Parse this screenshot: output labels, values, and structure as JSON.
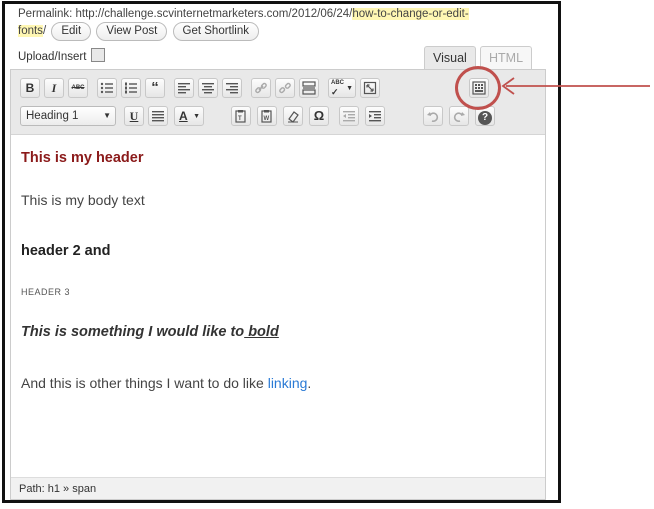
{
  "permalink": {
    "prefix": "Permalink: http://challenge.scvinternetmarketers.com/2012/06/24/",
    "slug_part1": "how-to-change-or-edit-",
    "slug_part2": "fonts",
    "suffix": "/",
    "edit": "Edit",
    "view_post": "View Post",
    "get_shortlink": "Get Shortlink"
  },
  "upload": {
    "label": "Upload/Insert"
  },
  "tabs": {
    "visual": "Visual",
    "html": "HTML"
  },
  "toolbar": {
    "row1": [
      "bold-icon",
      "italic-icon",
      "strikethrough-icon",
      "bullet-list-icon",
      "numbered-list-icon",
      "blockquote-icon",
      "align-left-icon",
      "align-center-icon",
      "align-right-icon",
      "link-icon",
      "unlink-icon",
      "insert-more-icon",
      "spellcheck-icon",
      "fullscreen-icon",
      "kitchen-sink-icon"
    ],
    "row2": [
      "underline-icon",
      "justify-icon",
      "text-color-icon",
      "paste-text-icon",
      "paste-word-icon",
      "clear-formatting-icon",
      "special-char-icon",
      "outdent-icon",
      "indent-icon",
      "undo-icon",
      "redo-icon",
      "help-icon"
    ],
    "format_select": "Heading 1",
    "b": "B",
    "i": "I",
    "abc": "ABC",
    "quote": "“",
    "u": "U",
    "a": "A",
    "omega": "Ω",
    "help": "?"
  },
  "content": {
    "h1": "This is my header",
    "body1": "This is my body text",
    "h2": "header 2 and",
    "h3": "HEADER 3",
    "bold_text_part1": "This is something I would like to",
    "bold_text_part2": " bold",
    "body2_part1": "And this is other things I want to do like ",
    "body2_link": "linking",
    "body2_part2": "."
  },
  "path": {
    "label": "Path:",
    "value": "h1 » span"
  },
  "colors": {
    "header": "#8b1a1a",
    "link": "#2a7ad5",
    "highlight_circle": "#c0504d"
  }
}
